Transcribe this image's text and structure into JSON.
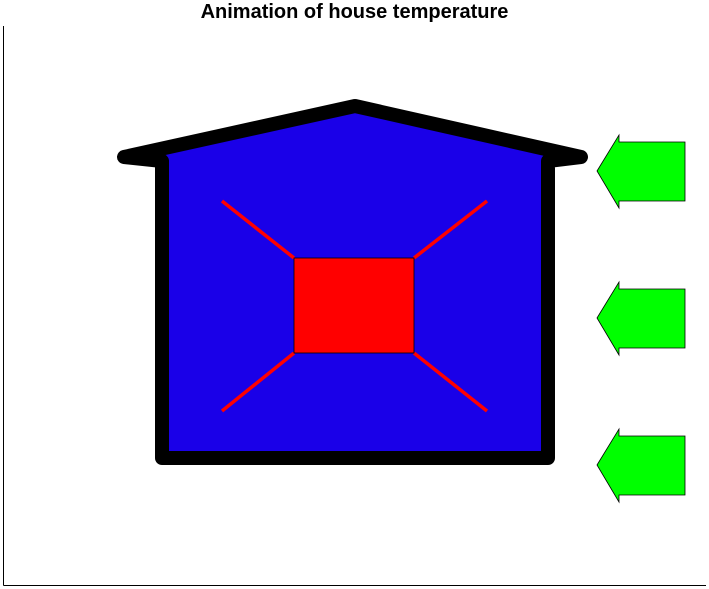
{
  "figure": {
    "title": "Animation of house temperature"
  },
  "colors": {
    "house_fill": "#1A00E8",
    "house_outline": "#000000",
    "heater_fill": "#FF0000",
    "heater_rays": "#FF0000",
    "arrow_fill": "#00FF00",
    "arrow_outline": "#000000",
    "axes": "#000000",
    "background": "#FFFFFF"
  },
  "icons": {
    "heater": "heater-icon",
    "heat_arrow": "arrow-left-icon"
  },
  "elements": {
    "house": "house-body",
    "heater_count": 1,
    "heat_ray_count": 4,
    "heat_arrow_count": 3
  }
}
